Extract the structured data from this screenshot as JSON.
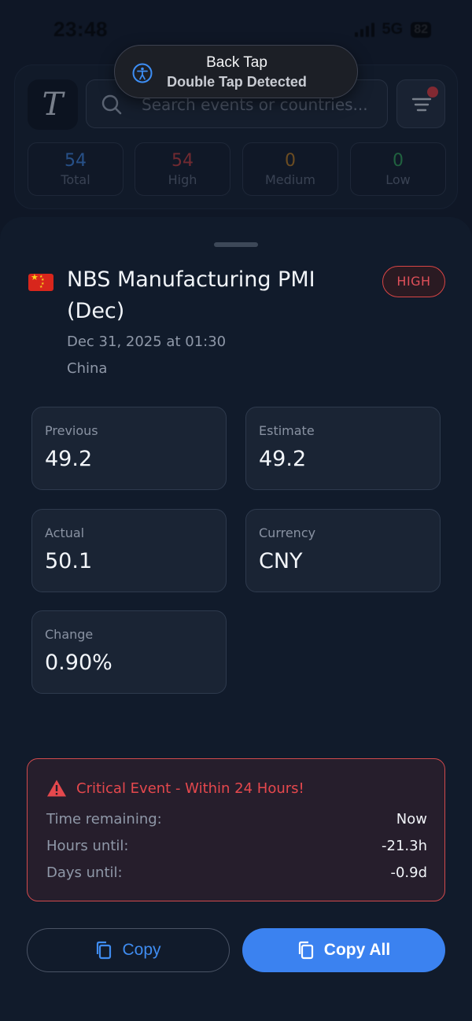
{
  "status_bar": {
    "time": "23:48",
    "network": "5G",
    "battery": "82"
  },
  "toast": {
    "title": "Back Tap",
    "message": "Double Tap Detected",
    "icon": "accessibility-icon"
  },
  "header": {
    "logo_text": "T",
    "search_placeholder": "Search events or countries...",
    "filter_icon": "filter-icon",
    "stats": [
      {
        "value": "54",
        "label": "Total",
        "color": "#3b7fd9"
      },
      {
        "value": "54",
        "label": "High",
        "color": "#c23a3a"
      },
      {
        "value": "0",
        "label": "Medium",
        "color": "#b7791f"
      },
      {
        "value": "0",
        "label": "Low",
        "color": "#2f9e55"
      }
    ]
  },
  "event": {
    "country_flag": "china-flag",
    "title": "NBS Manufacturing PMI (Dec)",
    "impact": "HIGH",
    "datetime": "Dec 31, 2025 at 01:30",
    "country": "China",
    "metrics": [
      {
        "label": "Previous",
        "value": "49.2"
      },
      {
        "label": "Estimate",
        "value": "49.2"
      },
      {
        "label": "Actual",
        "value": "50.1"
      },
      {
        "label": "Currency",
        "value": "CNY"
      },
      {
        "label": "Change",
        "value": "0.90%"
      }
    ]
  },
  "alert": {
    "title": "Critical Event - Within 24 Hours!",
    "rows": [
      {
        "label": "Time remaining:",
        "value": "Now"
      },
      {
        "label": "Hours until:",
        "value": "-21.3h"
      },
      {
        "label": "Days until:",
        "value": "-0.9d"
      }
    ],
    "color": "#e5484d"
  },
  "actions": {
    "copy_label": "Copy",
    "copy_all_label": "Copy All",
    "accent": "#3b82f0"
  }
}
